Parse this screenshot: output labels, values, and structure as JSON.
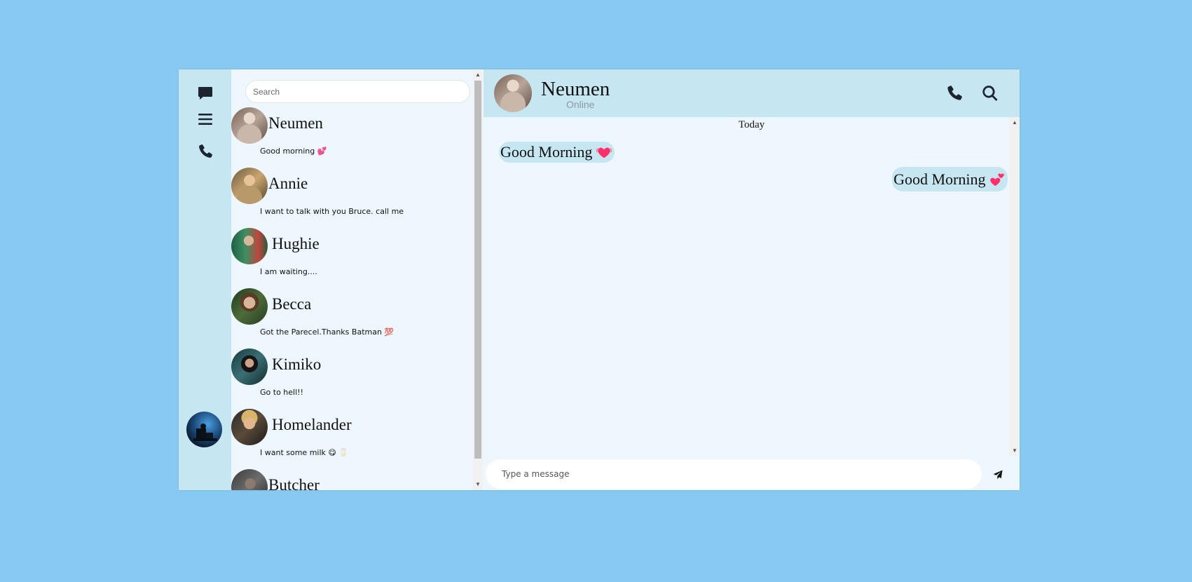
{
  "rail": {
    "icons": [
      "chat-icon",
      "menu-icon",
      "phone-icon"
    ]
  },
  "search": {
    "placeholder": "Search"
  },
  "contacts": [
    {
      "name": "Neumen",
      "preview": "Good morning 💕"
    },
    {
      "name": "Annie",
      "preview": "I want to talk with you Bruce. call me"
    },
    {
      "name": "Hughie",
      "preview": "I am waiting...."
    },
    {
      "name": "Becca",
      "preview": "Got the Parecel.Thanks Batman 💯"
    },
    {
      "name": "Kimiko",
      "preview": "Go to hell!!"
    },
    {
      "name": "Homelander",
      "preview": "I want some milk 😋 🥛"
    },
    {
      "name": "Butcher",
      "preview": ""
    }
  ],
  "chat": {
    "name": "Neumen",
    "status": "Online",
    "date_label": "Today",
    "messages": [
      {
        "side": "left",
        "text": "Good Morning"
      },
      {
        "side": "right",
        "text": "Good Morning"
      }
    ],
    "composer_placeholder": "Type a message"
  },
  "colors": {
    "page_background": "#87c9f1",
    "panel_background": "#c6e6f2",
    "list_background": "#eef7fd",
    "heart": "#ff2f6a"
  }
}
